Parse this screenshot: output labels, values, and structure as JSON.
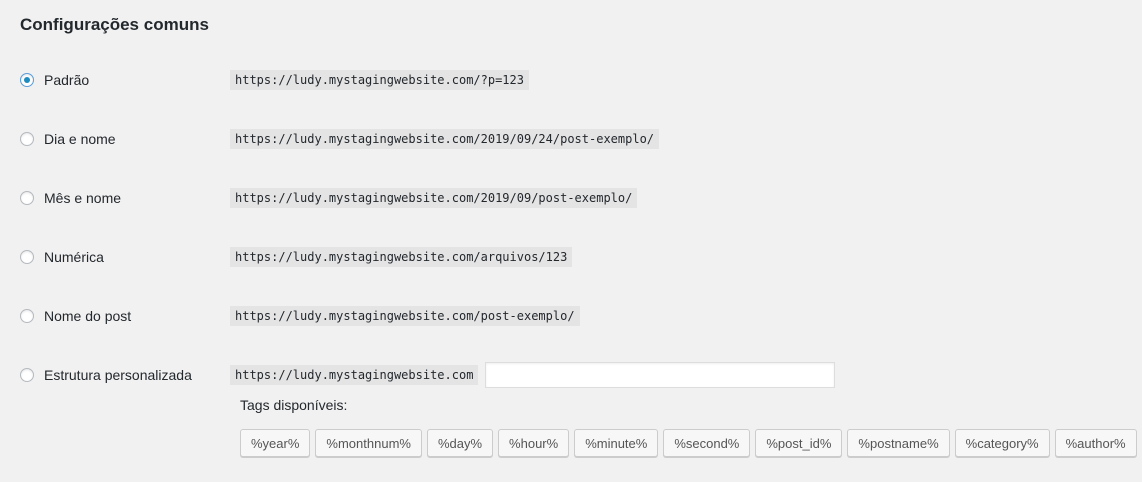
{
  "section": {
    "title": "Configurações comuns"
  },
  "options": [
    {
      "label": "Padrão",
      "example": "https://ludy.mystagingwebsite.com/?p=123",
      "checked": true
    },
    {
      "label": "Dia e nome",
      "example": "https://ludy.mystagingwebsite.com/2019/09/24/post-exemplo/",
      "checked": false
    },
    {
      "label": "Mês e nome",
      "example": "https://ludy.mystagingwebsite.com/2019/09/post-exemplo/",
      "checked": false
    },
    {
      "label": "Numérica",
      "example": "https://ludy.mystagingwebsite.com/arquivos/123",
      "checked": false
    },
    {
      "label": "Nome do post",
      "example": "https://ludy.mystagingwebsite.com/post-exemplo/",
      "checked": false
    },
    {
      "label": "Estrutura personalizada",
      "example": "https://ludy.mystagingwebsite.com",
      "checked": false
    }
  ],
  "custom_structure": {
    "value": ""
  },
  "tags": {
    "label": "Tags disponíveis:",
    "items": [
      "%year%",
      "%monthnum%",
      "%day%",
      "%hour%",
      "%minute%",
      "%second%",
      "%post_id%",
      "%postname%",
      "%category%",
      "%author%"
    ]
  },
  "colors": {
    "background": "#f1f1f1",
    "accent": "#1e8cbe",
    "code_background": "#e4e4e4"
  }
}
